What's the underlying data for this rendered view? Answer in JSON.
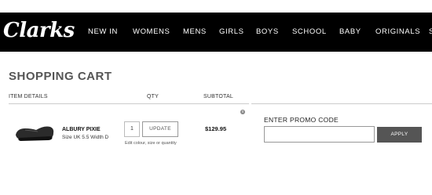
{
  "header": {
    "logo_text": "Clarks",
    "nav": [
      "NEW IN",
      "WOMENS",
      "MENS",
      "GIRLS",
      "BOYS",
      "SCHOOL",
      "BABY",
      "ORIGINALS",
      "S"
    ]
  },
  "cart": {
    "title": "SHOPPING CART",
    "columns": {
      "item": "ITEM DETAILS",
      "qty": "QTY",
      "subtotal": "SUBTOTAL"
    },
    "items": [
      {
        "name": "ALBURY PIXIE",
        "size": "Size UK 5.5 Width D",
        "quantity": "1",
        "update_label": "UPDATE",
        "edit_label": "Edit colour, size or quantity",
        "subtotal": "$129.95",
        "remove_icon": "x"
      }
    ]
  },
  "promo": {
    "label": "ENTER PROMO CODE",
    "input_value": "",
    "apply_label": "APPLY"
  }
}
